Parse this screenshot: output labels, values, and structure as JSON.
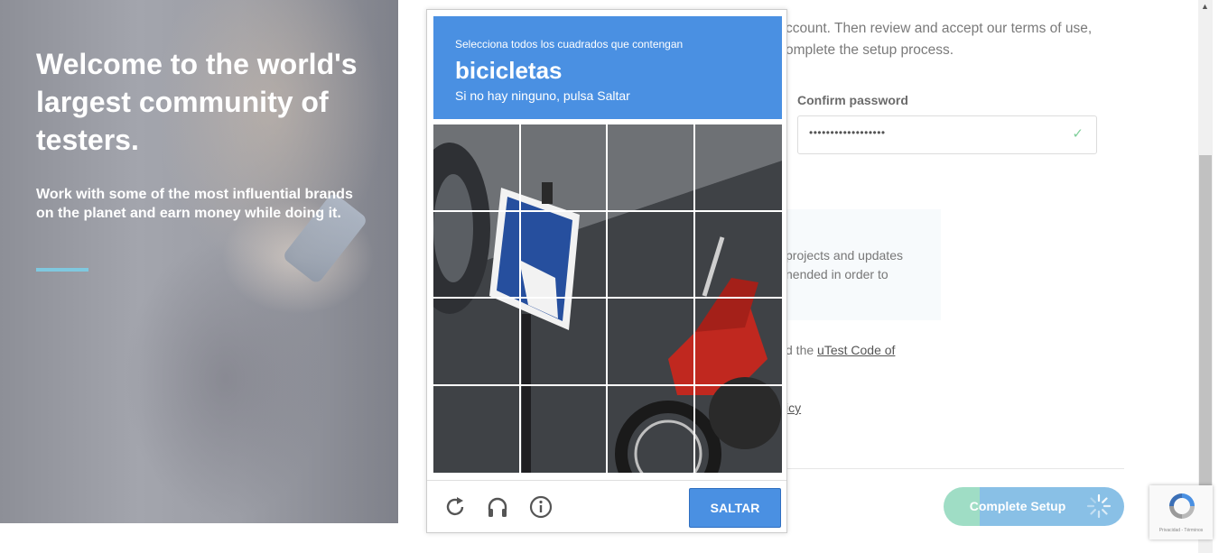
{
  "hero": {
    "title": "Welcome to the world's largest community of testers.",
    "subtitle": "Work with some of the most influential brands on the planet and earn money while doing it."
  },
  "form": {
    "intro_line1": "ccount. Then review and accept our terms of use,",
    "intro_line2": "omplete the setup process.",
    "confirm_password_label": "Confirm password",
    "confirm_password_value": "••••••••••••••••••",
    "info_line1": "projects and updates",
    "info_line2": "nended in order to",
    "code_prefix": "d the ",
    "code_link": "uTest Code of",
    "policy_link": "icy",
    "complete_button": "Complete Setup"
  },
  "captcha": {
    "instruction": "Selecciona todos los cuadrados que contengan",
    "keyword": "bicicletas",
    "hint": "Si no hay ninguno, pulsa Saltar",
    "skip_button": "SALTAR",
    "accent_color": "#4a90e2"
  },
  "recaptcha_badge": {
    "footer": "Privacidad - Términos"
  },
  "icons": [
    "reload-icon",
    "audio-icon",
    "info-icon",
    "checkmark-icon",
    "spinner-icon",
    "recaptcha-logo-icon"
  ]
}
